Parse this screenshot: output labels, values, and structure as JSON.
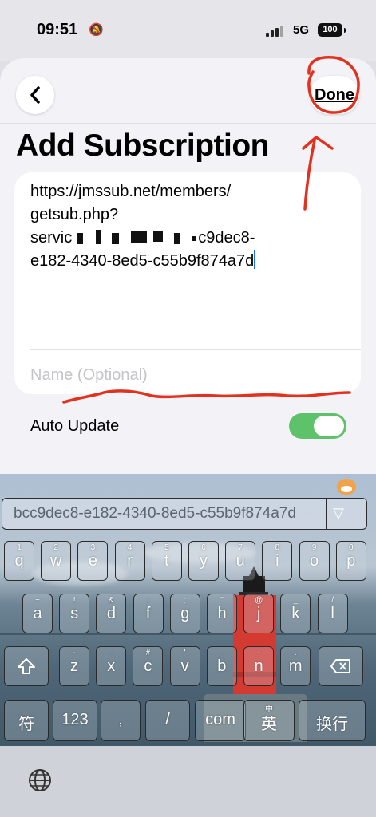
{
  "status_bar": {
    "time": "09:51",
    "network": "5G",
    "battery": "100"
  },
  "nav": {
    "done_label": "Done"
  },
  "page": {
    "title": "Add Subscription"
  },
  "form": {
    "url_lines": [
      "https://jmssub.net/members/",
      "getsub.php?",
      "servic",
      "c9dec8-",
      "e182-4340-8ed5-c55b9f874a7d"
    ],
    "name_placeholder": "Name (Optional)",
    "auto_update_label": "Auto Update",
    "auto_update_on": true
  },
  "keyboard": {
    "candidate": "bcc9dec8-e182-4340-8ed5-c55b9f874a7d",
    "row1": [
      {
        "k": "q",
        "s": "1"
      },
      {
        "k": "w",
        "s": "2"
      },
      {
        "k": "e",
        "s": "3"
      },
      {
        "k": "r",
        "s": "4"
      },
      {
        "k": "t",
        "s": "5"
      },
      {
        "k": "y",
        "s": "6"
      },
      {
        "k": "u",
        "s": "7"
      },
      {
        "k": "i",
        "s": "8"
      },
      {
        "k": "o",
        "s": "9"
      },
      {
        "k": "p",
        "s": "0"
      }
    ],
    "row2": [
      {
        "k": "a",
        "s": "~"
      },
      {
        "k": "s",
        "s": "!"
      },
      {
        "k": "d",
        "s": "&"
      },
      {
        "k": "f",
        "s": ":"
      },
      {
        "k": "g",
        "s": ";"
      },
      {
        "k": "h",
        "s": "\""
      },
      {
        "k": "j",
        "s": "@"
      },
      {
        "k": "k",
        "s": "_"
      },
      {
        "k": "l",
        "s": "/"
      }
    ],
    "row3": [
      {
        "k": "z",
        "s": "-"
      },
      {
        "k": "x",
        "s": "·"
      },
      {
        "k": "c",
        "s": "#"
      },
      {
        "k": "v",
        "s": "'"
      },
      {
        "k": "b",
        "s": "·"
      },
      {
        "k": "n",
        "s": "-"
      },
      {
        "k": "m",
        "s": "."
      }
    ],
    "row4": [
      {
        "k": "符",
        "s": ""
      },
      {
        "k": "123",
        "s": ""
      },
      {
        "k": ",",
        "s": ""
      },
      {
        "k": "/",
        "s": ""
      },
      {
        "k": "com",
        "s": ""
      },
      {
        "k": "英",
        "s": "中"
      },
      {
        "k": "换行",
        "s": ""
      }
    ],
    "accent": "#5ec26a",
    "annotation_color": "#e2321f"
  }
}
